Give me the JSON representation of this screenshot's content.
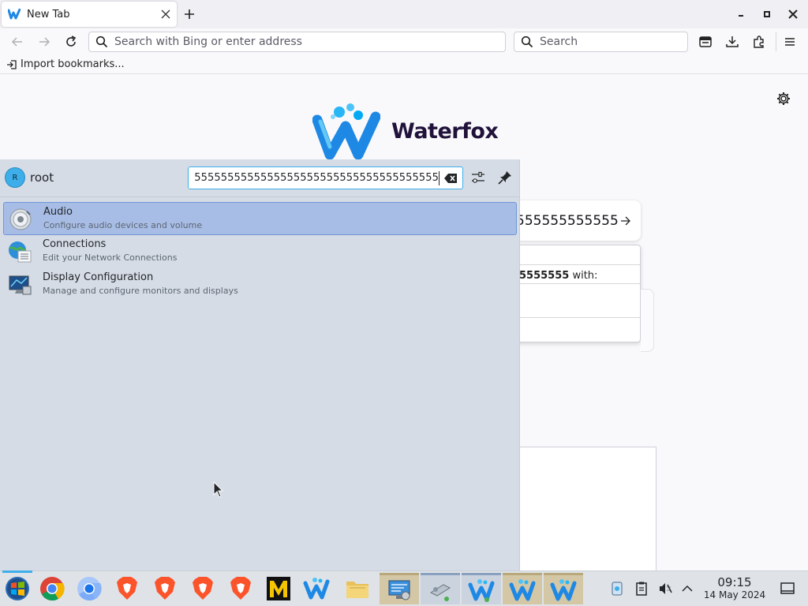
{
  "browser": {
    "tab_title": "New Tab",
    "url_placeholder": "Search with Bing or enter address",
    "search_placeholder": "Search",
    "bookmark_import": "Import bookmarks..."
  },
  "newtab": {
    "logo_text": "Waterfox",
    "search_text": "555555555555",
    "suggest_bold": "5555555",
    "suggest_tail": " with:"
  },
  "krunner": {
    "avatar_initial": "R",
    "username": "root",
    "query": "55555555555555555555555555555555555555555555555",
    "results": [
      {
        "name": "Audio",
        "description": "Configure audio devices and volume",
        "icon": "audio-settings-icon",
        "selected": true
      },
      {
        "name": "Connections",
        "description": "Edit your Network Connections",
        "icon": "network-connections-icon",
        "selected": false
      },
      {
        "name": "Display Configuration",
        "description": "Manage and configure monitors and displays",
        "icon": "display-configuration-icon",
        "selected": false
      }
    ]
  },
  "taskbar": {
    "apps": [
      "start-menu-icon",
      "chrome-icon",
      "chromium-icon",
      "brave-icon",
      "brave-icon",
      "brave-icon",
      "brave-icon",
      "m-app-icon",
      "waterfox-icon",
      "file-manager-icon",
      "system-settings-icon",
      "network-tool-icon",
      "waterfox-icon",
      "waterfox-icon",
      "waterfox-icon"
    ],
    "time": "09:15",
    "date": "14 May 2024"
  },
  "colors": {
    "accent": "#3daee9",
    "selection": "#a8bde6",
    "krunner_bg": "#d5dce6",
    "waterfox_blue": "#1e88e5"
  }
}
